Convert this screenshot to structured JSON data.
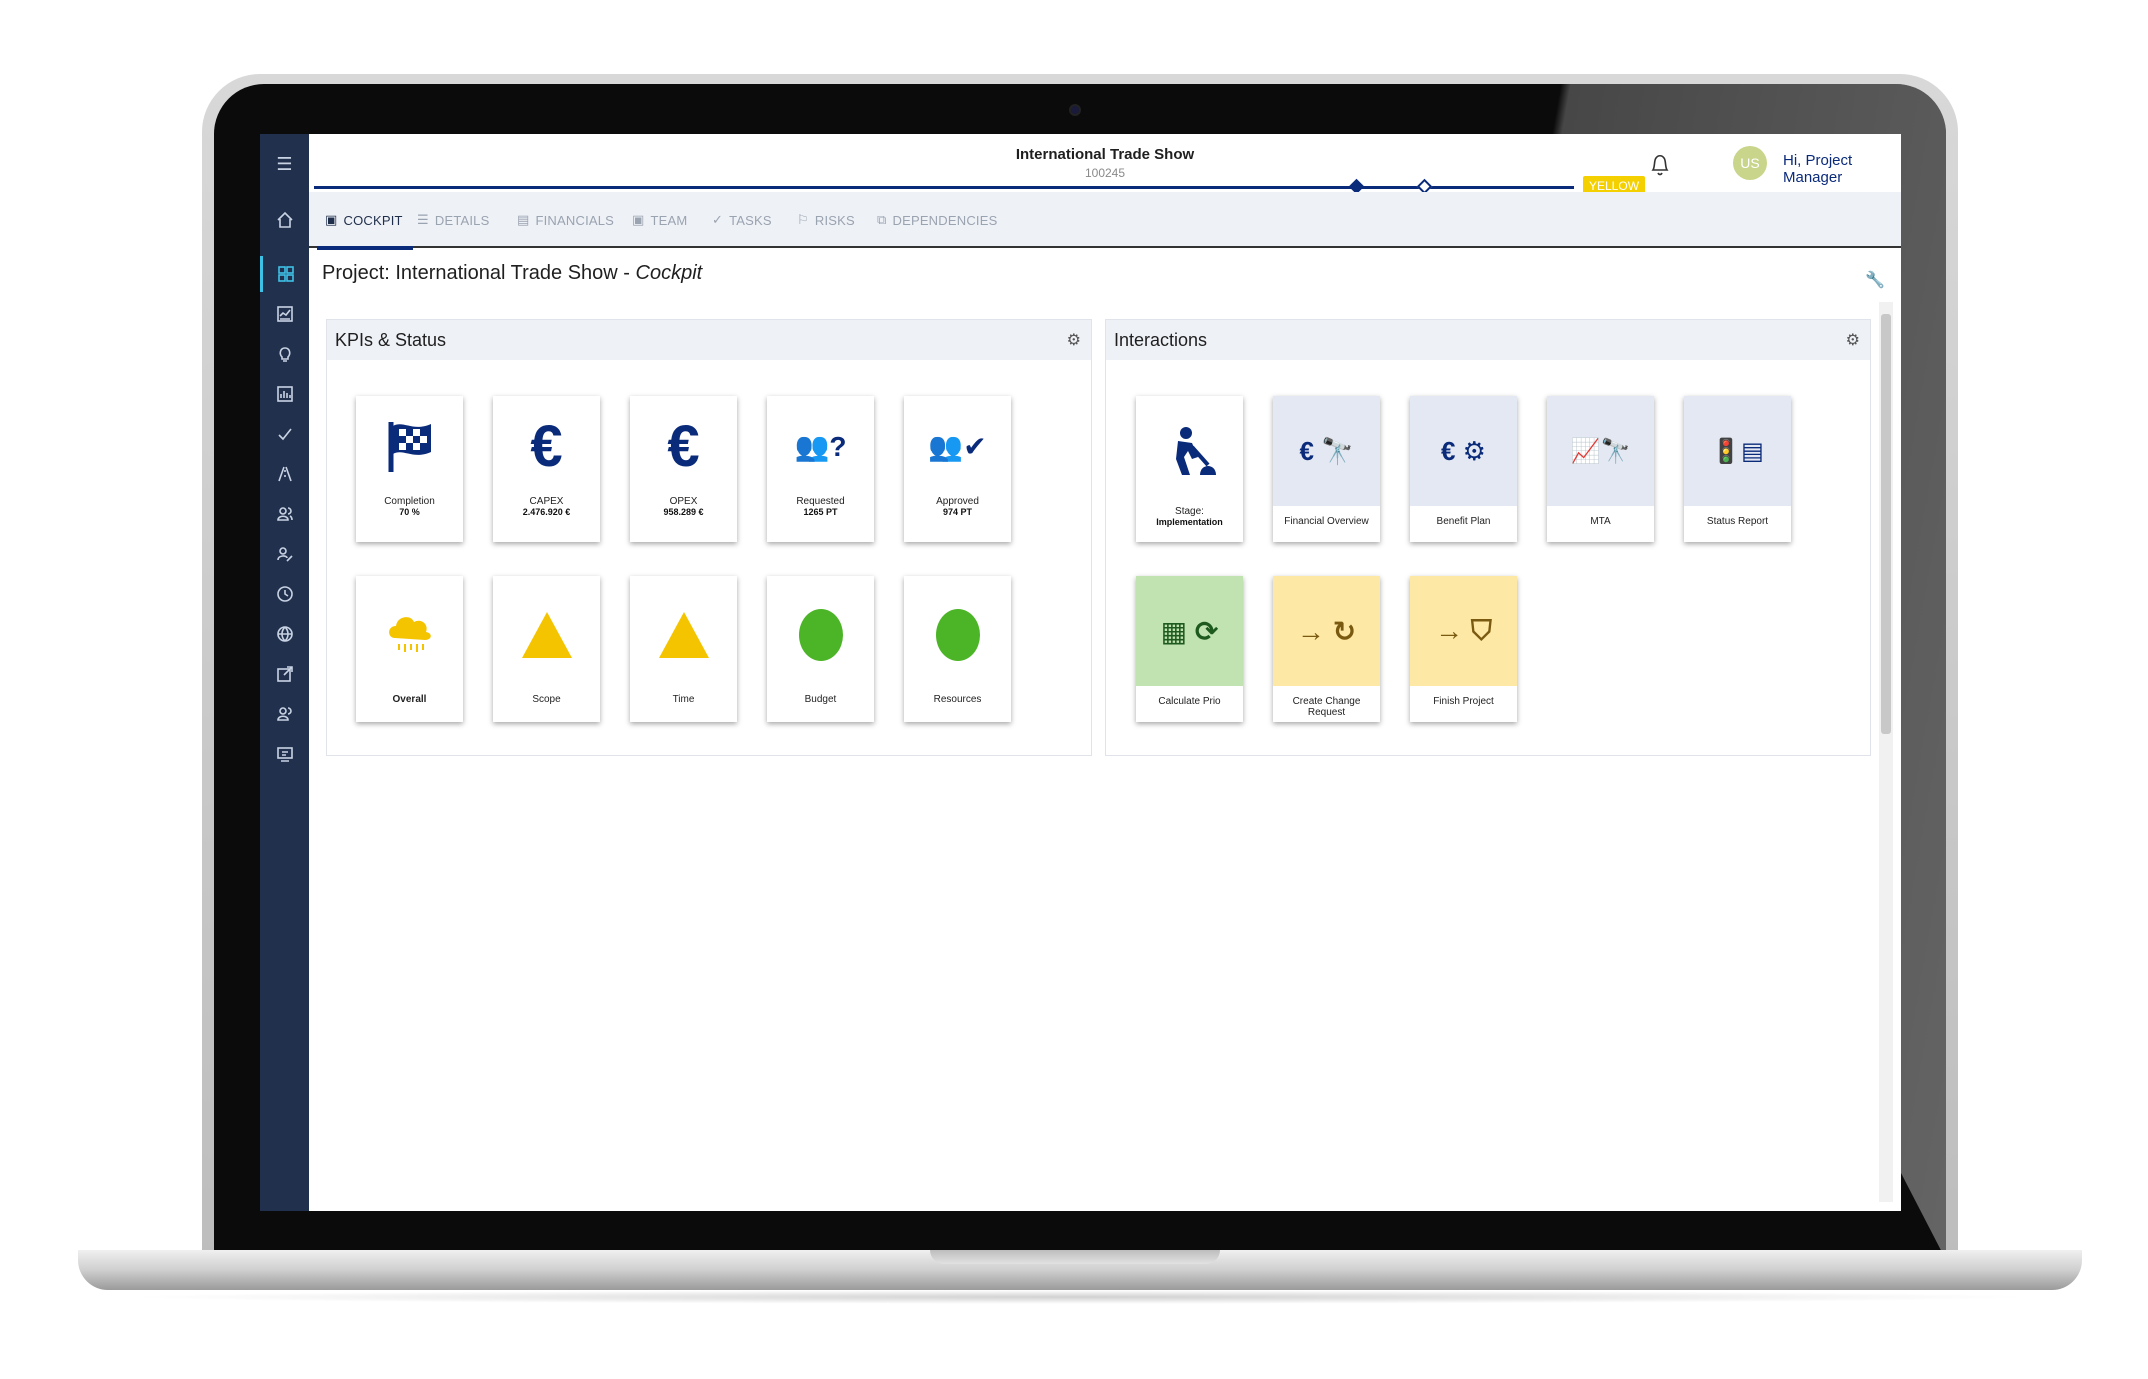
{
  "header": {
    "title": "International Trade Show",
    "subtitle": "100245",
    "status_chip": "YELLOW",
    "user_initials": "US",
    "user_greeting": "Hi, Project Manager",
    "colors": {
      "brand": "#0a2a7a",
      "sidebar": "#21314d",
      "accent": "#3ec1e6",
      "status_yellow": "#f5d000"
    }
  },
  "tabs": [
    {
      "label": "COCKPIT",
      "icon": "monitor-icon",
      "active": true
    },
    {
      "label": "DETAILS",
      "icon": "list-icon"
    },
    {
      "label": "FINANCIALS",
      "icon": "money-icon"
    },
    {
      "label": "TEAM",
      "icon": "team-icon"
    },
    {
      "label": "TASKS",
      "icon": "check-icon"
    },
    {
      "label": "RISKS",
      "icon": "flag-icon"
    },
    {
      "label": "DEPENDENCIES",
      "icon": "dependencies-icon"
    }
  ],
  "sidebar": {
    "items": [
      {
        "name": "menu"
      },
      {
        "name": "home"
      },
      {
        "name": "dashboard",
        "active": true
      },
      {
        "name": "reports"
      },
      {
        "name": "ideas"
      },
      {
        "name": "analytics"
      },
      {
        "name": "tasks"
      },
      {
        "name": "roadmap"
      },
      {
        "name": "users"
      },
      {
        "name": "user-settings"
      },
      {
        "name": "time"
      },
      {
        "name": "global"
      },
      {
        "name": "export"
      },
      {
        "name": "teams"
      },
      {
        "name": "billing"
      }
    ]
  },
  "page": {
    "title_prefix": "Project: International Trade Show - ",
    "title_italic": "Cockpit"
  },
  "kpi_panel": {
    "title": "KPIs & Status",
    "kpis": [
      {
        "label": "Completion",
        "value": "70 %",
        "icon": "checkered-flag-icon"
      },
      {
        "label": "CAPEX",
        "value": "2.476.920 €",
        "icon": "euro-icon"
      },
      {
        "label": "OPEX",
        "value": "958.289 €",
        "icon": "euro-icon"
      },
      {
        "label": "Requested",
        "value": "1265 PT",
        "icon": "team-question-icon"
      },
      {
        "label": "Approved",
        "value": "974 PT",
        "icon": "team-check-icon"
      }
    ],
    "statuses": [
      {
        "label": "Overall",
        "status": "rain",
        "color": "#f5c400"
      },
      {
        "label": "Scope",
        "status": "yellow",
        "color": "#f5c400"
      },
      {
        "label": "Time",
        "status": "yellow",
        "color": "#f5c400"
      },
      {
        "label": "Budget",
        "status": "green",
        "color": "#4cb527"
      },
      {
        "label": "Resources",
        "status": "green",
        "color": "#4cb527"
      }
    ]
  },
  "interactions_panel": {
    "title": "Interactions",
    "stage_label": "Stage:",
    "stage_value": "Implementation",
    "actions": [
      {
        "label": "Financial Overview",
        "icon": "euro-binoculars-icon"
      },
      {
        "label": "Benefit Plan",
        "icon": "euro-gears-icon"
      },
      {
        "label": "MTA",
        "icon": "chart-binoculars-icon"
      },
      {
        "label": "Status Report",
        "icon": "traffic-light-report-icon"
      },
      {
        "label": "Calculate Prio",
        "icon": "calculator-refresh-icon"
      },
      {
        "label": "Create Change Request",
        "icon": "arrow-redo-icon"
      },
      {
        "label": "Finish Project",
        "icon": "arrow-stamp-icon"
      }
    ]
  }
}
